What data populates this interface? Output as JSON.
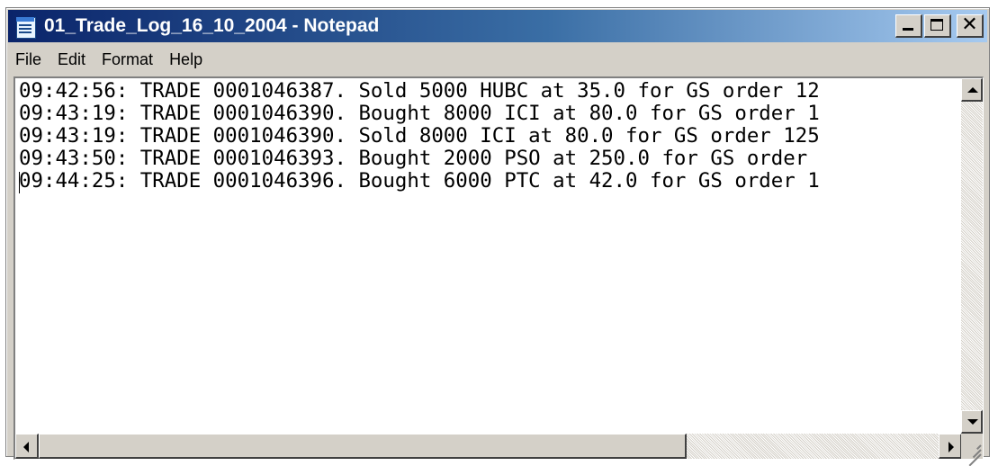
{
  "window": {
    "title": "01_Trade_Log_16_10_2004 - Notepad",
    "title_gradient_start": "#0a246a",
    "title_gradient_end": "#a6caf0",
    "icon": "notepad-icon"
  },
  "title_buttons": {
    "minimize_icon": "minimize-icon",
    "maximize_icon": "maximize-icon",
    "close_icon": "close-icon",
    "close_glyph": "✕"
  },
  "menu": {
    "items": [
      {
        "label": "File"
      },
      {
        "label": "Edit"
      },
      {
        "label": "Format"
      },
      {
        "label": "Help"
      }
    ]
  },
  "editor": {
    "lines": [
      "09:42:56: TRADE 0001046387. Sold 5000 HUBC at 35.0 for GS order 12",
      "09:43:19: TRADE 0001046390. Bought 8000 ICI at 80.0 for GS order 1",
      "09:43:19: TRADE 0001046390. Sold 8000 ICI at 80.0 for GS order 125",
      "09:43:50: TRADE 0001046393. Bought 2000 PSO at 250.0 for GS order ",
      "09:44:25: TRADE 0001046396. Bought 6000 PTC at 42.0 for GS order 1"
    ]
  },
  "scrollbars": {
    "horizontal_thumb_fraction": 0.72,
    "vertical_thumb": "none"
  }
}
